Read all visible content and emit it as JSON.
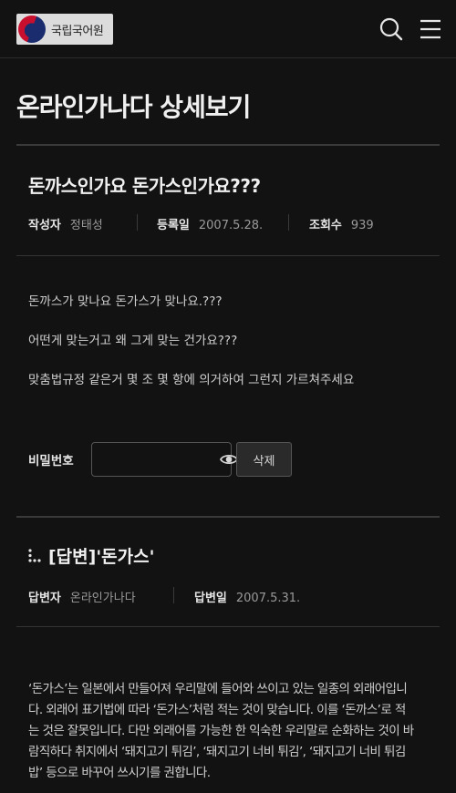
{
  "header": {
    "logo_text": "국립국어원",
    "search_icon": "search-icon",
    "menu_icon": "hamburger-menu-icon"
  },
  "page_title": "온라인가나다 상세보기",
  "post": {
    "title": "돈까스인가요 돈가스인가요???",
    "author_label": "작성자",
    "author": "정태성",
    "date_label": "등록일",
    "date": "2007.5.28.",
    "views_label": "조회수",
    "views": "939",
    "body": [
      "돈까스가 맞나요 돈가스가 맞나요.???",
      "어떤게 맞는거고 왜 그게 맞는 건가요???",
      "맞춤법규정 같은거 몇 조 몇 항에 의거하여 그런지 가르쳐주세요"
    ]
  },
  "password": {
    "label": "비밀번호",
    "value": "",
    "placeholder": "",
    "eye_icon": "eye-icon",
    "delete_label": "삭제"
  },
  "answer": {
    "title": "[답변]'돈가스'",
    "answerer_label": "답변자",
    "answerer": "온라인가나다",
    "date_label": "답변일",
    "date": "2007.5.31.",
    "lines": [
      "‘돈가스’는 일본에서 만들어져 우리말에 들어와 쓰이고 있는 일종의 외래어입니",
      "다. 외래어 표기법에 따라 ‘돈가스’처럼 적는 것이 맞습니다. 이를 ‘돈까스’로 적",
      "는 것은 잘못입니다. 다만 외래어를 가능한 한 익숙한 우리말로 순화하는 것이 바",
      "람직하다 취지에서 ‘돼지고기 튀김’, ‘돼지고기 너비 튀김’, ‘돼지고기 너비 튀김",
      "밥’ 등으로 바꾸어 쓰시기를 권합니다."
    ]
  },
  "colors": {
    "background": "#121212",
    "text": "#e6e6e6",
    "muted": "#9a9a9a"
  }
}
